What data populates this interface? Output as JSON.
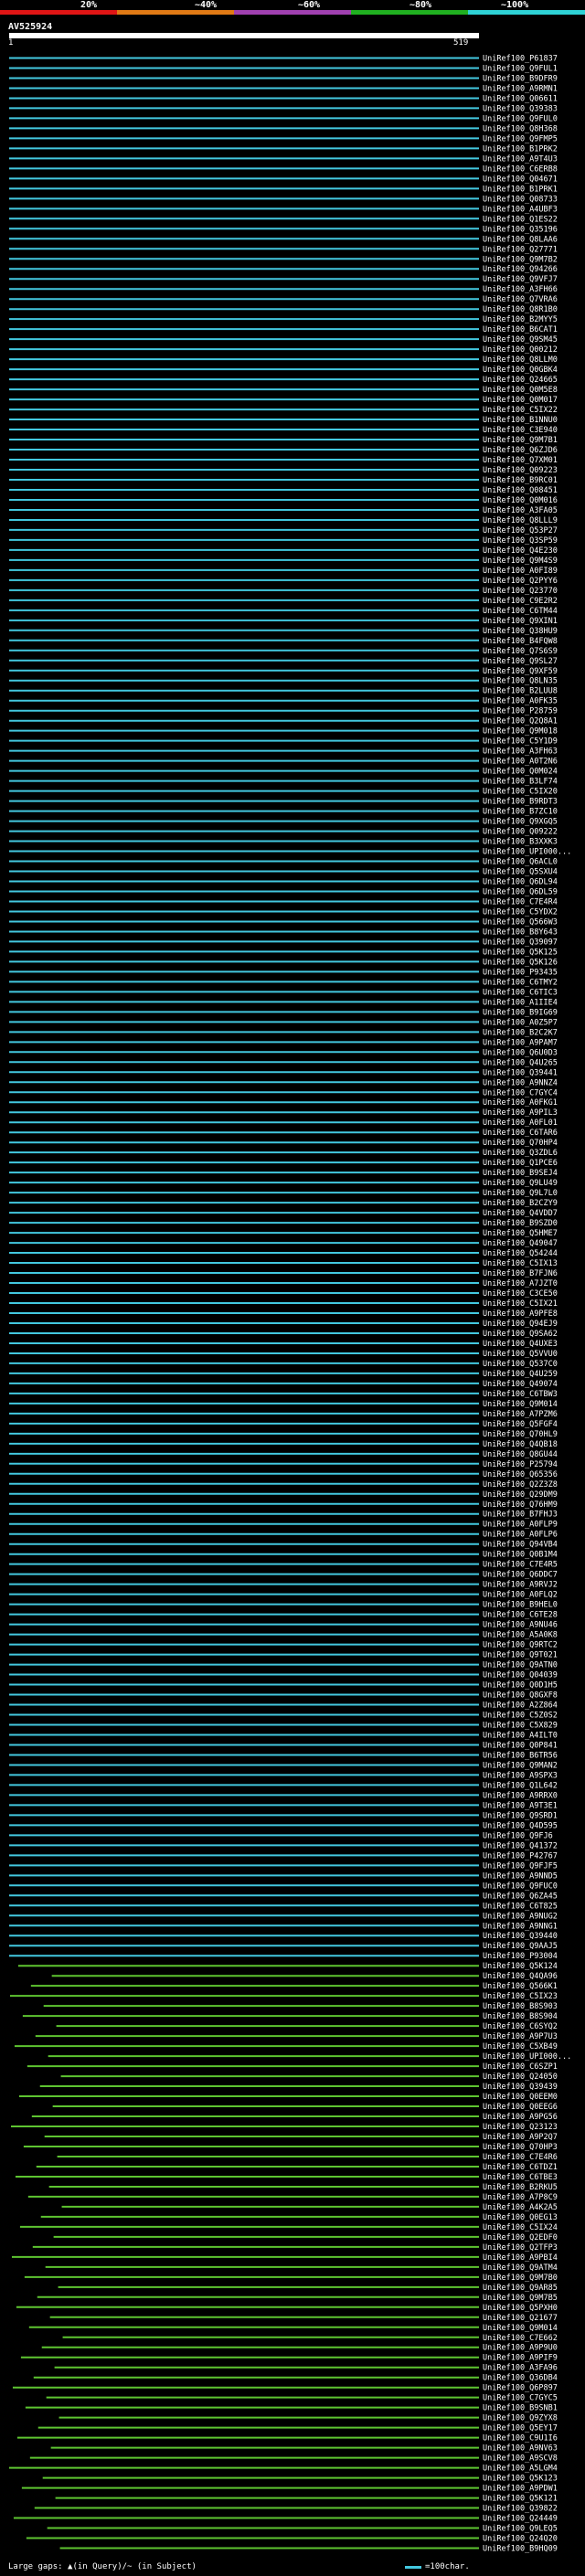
{
  "query_id": "AV525924",
  "axis": {
    "start": "1",
    "end": "519"
  },
  "identity_scale": [
    {
      "label": "20%",
      "color": "#e01515"
    },
    {
      "label": "~40%",
      "color": "#e07a15"
    },
    {
      "label": "~60%",
      "color": "#a040b0"
    },
    {
      "label": "~80%",
      "color": "#20b020"
    },
    {
      "label": "~100%",
      "color": "#2ed2d6"
    }
  ],
  "legend": {
    "gaps": "Large gaps: ▲(in Query)/~ (in Subject)",
    "scale": "=100char."
  },
  "chart_data": {
    "type": "bar",
    "title": "AV525924",
    "x_range": [
      1,
      519
    ],
    "categories": [
      "UniRef100_P61837",
      "UniRef100_Q9FUL1",
      "UniRef100_B9DFR9",
      "UniRef100_A9RMN1",
      "UniRef100_Q06611",
      "UniRef100_Q39383",
      "UniRef100_Q9FUL0",
      "UniRef100_Q8H368",
      "UniRef100_Q9FMP5",
      "UniRef100_B1PRK2",
      "UniRef100_A9T4U3",
      "UniRef100_C6ERB8",
      "UniRef100_Q04671",
      "UniRef100_B1PRK1",
      "UniRef100_Q08733",
      "UniRef100_A4UBF3",
      "UniRef100_Q1ES22",
      "UniRef100_Q35196",
      "UniRef100_Q8LAA6",
      "UniRef100_Q27771",
      "UniRef100_Q9M7B2",
      "UniRef100_Q94266",
      "UniRef100_Q9VFJ7",
      "UniRef100_A3FH66",
      "UniRef100_Q7VRA6",
      "UniRef100_Q8R1B0",
      "UniRef100_B2MYY5",
      "UniRef100_B6CAT1",
      "UniRef100_Q9SM45",
      "UniRef100_Q00212",
      "UniRef100_Q8LLM0",
      "UniRef100_Q0GBK4",
      "UniRef100_Q24665",
      "UniRef100_Q0M5E8",
      "UniRef100_Q0M017",
      "UniRef100_C5IX22",
      "UniRef100_B1NNU0",
      "UniRef100_C3E940",
      "UniRef100_Q9M7B1",
      "UniRef100_Q6ZJD6",
      "UniRef100_Q7XM01",
      "UniRef100_Q09223",
      "UniRef100_B9RC01",
      "UniRef100_Q08451",
      "UniRef100_Q0M016",
      "UniRef100_A3FA05",
      "UniRef100_Q8LLL9",
      "UniRef100_Q53P27",
      "UniRef100_Q3SP59",
      "UniRef100_Q4E230",
      "UniRef100_Q9M4S9",
      "UniRef100_A0FI89",
      "UniRef100_Q2PYY6",
      "UniRef100_Q23770",
      "UniRef100_C9E2R2",
      "UniRef100_C6TM44",
      "UniRef100_Q9XIN1",
      "UniRef100_Q38HU9",
      "UniRef100_B4FQW8",
      "UniRef100_Q7S6S9",
      "UniRef100_Q9SL27",
      "UniRef100_Q9XF59",
      "UniRef100_Q8LN35",
      "UniRef100_B2LUU8",
      "UniRef100_A0FK35",
      "UniRef100_P28759",
      "UniRef100_Q2Q8A1",
      "UniRef100_Q9M018",
      "UniRef100_C5Y1D9",
      "UniRef100_A3FH63",
      "UniRef100_A0T2N6",
      "UniRef100_Q0M024",
      "UniRef100_B3LF74",
      "UniRef100_C5IX20",
      "UniRef100_B9RDT3",
      "UniRef100_B7ZC10",
      "UniRef100_Q9XGQ5",
      "UniRef100_Q09222",
      "UniRef100_B3XXK3",
      "UniRef100_UPI000...",
      "UniRef100_Q6ACL0",
      "UniRef100_Q5SXU4",
      "UniRef100_Q6DL94",
      "UniRef100_Q6DL59",
      "UniRef100_C7E4R4",
      "UniRef100_C5YDX2",
      "UniRef100_Q566W3",
      "UniRef100_B8Y643",
      "UniRef100_Q39097",
      "UniRef100_Q5K125",
      "UniRef100_Q5K126",
      "UniRef100_P93435",
      "UniRef100_C6TMY2",
      "UniRef100_C6TIC3",
      "UniRef100_A1IIE4",
      "UniRef100_B9IG69",
      "UniRef100_A0Z5P7",
      "UniRef100_B2C2K7",
      "UniRef100_A9PAM7",
      "UniRef100_Q6U0D3",
      "UniRef100_Q4U265",
      "UniRef100_Q39441",
      "UniRef100_A9NNZ4",
      "UniRef100_C7GYC4",
      "UniRef100_A0FKG1",
      "UniRef100_A9PIL3",
      "UniRef100_A0FL01",
      "UniRef100_C6TAR6",
      "UniRef100_Q70HP4",
      "UniRef100_Q3ZDL6",
      "UniRef100_Q1PCE6",
      "UniRef100_B9SEJ4",
      "UniRef100_Q9LU49",
      "UniRef100_Q9L7L0",
      "UniRef100_B2CZY9",
      "UniRef100_Q4VDD7",
      "UniRef100_B9SZD0",
      "UniRef100_Q5HME7",
      "UniRef100_Q49047",
      "UniRef100_Q54244",
      "UniRef100_C5IX13",
      "UniRef100_B7FJN6",
      "UniRef100_A7JZT0",
      "UniRef100_C3CE50",
      "UniRef100_C5IX21",
      "UniRef100_A9PFE8",
      "UniRef100_Q94EJ9",
      "UniRef100_Q9SA62",
      "UniRef100_Q4UXE3",
      "UniRef100_Q5VVU0",
      "UniRef100_Q537C0",
      "UniRef100_Q4U259",
      "UniRef100_Q49074",
      "UniRef100_C6TBW3",
      "UniRef100_Q9M014",
      "UniRef100_A7PZM6",
      "UniRef100_Q5FGF4",
      "UniRef100_Q70HL9",
      "UniRef100_Q4QB18",
      "UniRef100_Q8GU44",
      "UniRef100_P25794",
      "UniRef100_Q65356",
      "UniRef100_Q2Z3Z8",
      "UniRef100_Q29DM9",
      "UniRef100_Q76HM9",
      "UniRef100_B7FHJ3",
      "UniRef100_A0FLP9",
      "UniRef100_A0FLP6",
      "UniRef100_Q94VB4",
      "UniRef100_Q0B1M4",
      "UniRef100_C7E4R5",
      "UniRef100_Q6DDC7",
      "UniRef100_A9RVJ2",
      "UniRef100_A0FLQ2",
      "UniRef100_B9HEL0",
      "UniRef100_C6TE28",
      "UniRef100_A9NU46",
      "UniRef100_A5A0K8",
      "UniRef100_Q9RTC2",
      "UniRef100_Q9T021",
      "UniRef100_Q9ATN0",
      "UniRef100_Q04039",
      "UniRef100_Q0D1H5",
      "UniRef100_Q8GXF8",
      "UniRef100_A2Z864",
      "UniRef100_C5Z0S2",
      "UniRef100_C5X829",
      "UniRef100_A4ILT0",
      "UniRef100_Q0P841",
      "UniRef100_B6TR56",
      "UniRef100_Q9MAN2",
      "UniRef100_A9SPX3",
      "UniRef100_Q1L642",
      "UniRef100_A9RRX0",
      "UniRef100_A9T3E1",
      "UniRef100_Q9SRD1",
      "UniRef100_Q4D595",
      "UniRef100_Q9FJ6",
      "UniRef100_Q41372",
      "UniRef100_P42767",
      "UniRef100_Q9FJF5",
      "UniRef100_A9NND5",
      "UniRef100_Q9FUC0",
      "UniRef100_Q6ZA45",
      "UniRef100_C6T825",
      "UniRef100_A9NUG2",
      "UniRef100_A9NNG1",
      "UniRef100_Q39440",
      "UniRef100_Q9AAJ5",
      "UniRef100_P93004",
      "UniRef100_Q5K124",
      "UniRef100_Q4QA96",
      "UniRef100_Q566K1",
      "UniRef100_C5IX23",
      "UniRef100_B8S903",
      "UniRef100_B8S904",
      "UniRef100_C6SYQ2",
      "UniRef100_A9P7U3",
      "UniRef100_C5XB49",
      "UniRef100_UPI000...",
      "UniRef100_C6SZP1",
      "UniRef100_Q24050",
      "UniRef100_Q39439",
      "UniRef100_Q0EEM0",
      "UniRef100_Q0EEG6",
      "UniRef100_A9PG56",
      "UniRef100_Q23123",
      "UniRef100_A9P2Q7",
      "UniRef100_Q70HP3",
      "UniRef100_C7E4R6",
      "UniRef100_C6TDZ1",
      "UniRef100_C6TBE3",
      "UniRef100_B2RKU5",
      "UniRef100_A7P8C9",
      "UniRef100_A4K2A5",
      "UniRef100_Q0EG13",
      "UniRef100_C5IX24",
      "UniRef100_Q2EDF0",
      "UniRef100_Q2TFP3",
      "UniRef100_A9PBI4",
      "UniRef100_Q9ATM4",
      "UniRef100_Q9M7B0",
      "UniRef100_Q9AR85",
      "UniRef100_Q9M7B5",
      "UniRef100_Q5PXH0",
      "UniRef100_Q21677",
      "UniRef100_Q9M014",
      "UniRef100_C7E662",
      "UniRef100_A9P9U0",
      "UniRef100_A9PIF9",
      "UniRef100_A3FA96",
      "UniRef100_Q36DB4",
      "UniRef100_Q6P897",
      "UniRef100_C7GYC5",
      "UniRef100_B9SNB1",
      "UniRef100_Q9ZYX8",
      "UniRef100_Q5EY17",
      "UniRef100_C9U1I6",
      "UniRef100_A9NV63",
      "UniRef100_A9SCV8",
      "UniRef100_A5LGM4",
      "UniRef100_Q5K123",
      "UniRef100_A9PDW1",
      "UniRef100_Q5K121",
      "UniRef100_Q39822",
      "UniRef100_Q24449",
      "UniRef100_Q9LEQ5",
      "UniRef100_Q24Q20",
      "UniRef100_B9HQ09"
    ],
    "series": [
      {
        "values": [
          1,
          1,
          1,
          1,
          1,
          1,
          1,
          1,
          1,
          1,
          1,
          1,
          1,
          1,
          1,
          1,
          1,
          1,
          1,
          1,
          1,
          1,
          1,
          1,
          1,
          1,
          1,
          1,
          1,
          1,
          1,
          1,
          1,
          1,
          1,
          1,
          1,
          1,
          1,
          1,
          1,
          1,
          1,
          1,
          1,
          1,
          1,
          1,
          1,
          1,
          1,
          1,
          1,
          1,
          1,
          1,
          1,
          1,
          1,
          1,
          1,
          1,
          1,
          1,
          1,
          1,
          1,
          1,
          1,
          1,
          1,
          1,
          1,
          1,
          1,
          1,
          1,
          1,
          1,
          1,
          1,
          1,
          1,
          1,
          1,
          1,
          1,
          1,
          1,
          1,
          1,
          1,
          1,
          1,
          1,
          1,
          1,
          1,
          1,
          1,
          1,
          1,
          1,
          1,
          1,
          1,
          1,
          1,
          1,
          1,
          1,
          1,
          1,
          1,
          1,
          1,
          1,
          1,
          1,
          1,
          1,
          1,
          1,
          1,
          1,
          1,
          1,
          1,
          1,
          1,
          1,
          1,
          1,
          1,
          1,
          1,
          1,
          1,
          1,
          1,
          1,
          1,
          1,
          1,
          1,
          1,
          1,
          1,
          1,
          1,
          1,
          1,
          1,
          1,
          1,
          1,
          1,
          1,
          1,
          1,
          1,
          1,
          1,
          1,
          1,
          1,
          1,
          1,
          1,
          1,
          1,
          1,
          1,
          1,
          1,
          1,
          1,
          1,
          1,
          1,
          1,
          1,
          1,
          1,
          1,
          1,
          1,
          1,
          1,
          1,
          1,
          1,
          1,
          1,
          1,
          1,
          1,
          1,
          1,
          1,
          1,
          1,
          1,
          1,
          1,
          1,
          1,
          1,
          1,
          1,
          1,
          1,
          1,
          1,
          1,
          1,
          1,
          1,
          1,
          1,
          1,
          1,
          1,
          1,
          1,
          1,
          1,
          1,
          1,
          1,
          1,
          1,
          1,
          1,
          1,
          1,
          1,
          1,
          1,
          1,
          1,
          1,
          1,
          1,
          1,
          1,
          1,
          1,
          1,
          1,
          1,
          1,
          1,
          1,
          1,
          1,
          1,
          1,
          1,
          1,
          1,
          1,
          1,
          1,
          1,
          1,
          1,
          1,
          1,
          1,
          1,
          1,
          1,
          1,
          1,
          1,
          1,
          1,
          1,
          1,
          1,
          1,
          1,
          1,
          1,
          1,
          1,
          1,
          1,
          1,
          1,
          1,
          1,
          1,
          1,
          1,
          1,
          1,
          1,
          1,
          1,
          1
        ]
      }
    ],
    "hit_colors": {
      "cyan": "#43c8df",
      "green": "#5ec431"
    }
  }
}
